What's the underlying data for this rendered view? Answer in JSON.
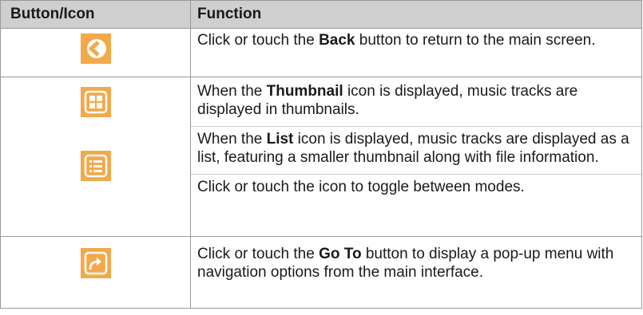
{
  "header": {
    "col1": "Button/Icon",
    "col2": "Function"
  },
  "rows": [
    {
      "icon": "back-icon",
      "text": [
        {
          "pre": "Click or touch the ",
          "bold": "Back",
          "post": " button to return to the main screen."
        }
      ]
    },
    {
      "icons": [
        "thumbnail-icon",
        "list-icon"
      ],
      "text": [
        {
          "pre": "When the ",
          "bold": "Thumbnail",
          "post": " icon is displayed, music tracks are displayed in thumbnails."
        },
        {
          "pre": "When the ",
          "bold": "List",
          "post": " icon is displayed, music tracks are displayed as a list, featuring a smaller thumbnail along with file information."
        },
        {
          "pre": "Click or touch the icon to toggle between modes.",
          "bold": "",
          "post": ""
        }
      ]
    },
    {
      "icon": "go-to-icon",
      "text": [
        {
          "pre": "Click or touch the ",
          "bold": "Go To",
          "post": " button to display a pop-up menu with navigation options from the main interface."
        }
      ]
    }
  ],
  "colors": {
    "header_bg": "#cfcfcf",
    "icon_bg": "#f3a94a",
    "border": "#999999"
  }
}
